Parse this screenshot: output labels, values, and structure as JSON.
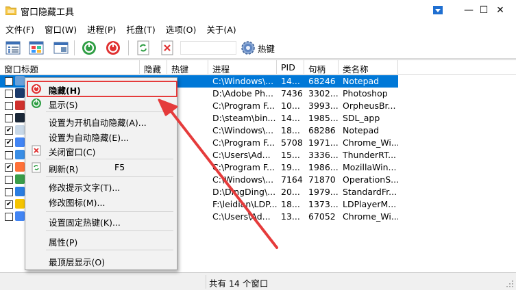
{
  "window": {
    "title": "窗口隐藏工具",
    "controls": {
      "help": "▼",
      "minimize": "—",
      "maximize": "☐",
      "close": "✕"
    }
  },
  "menu": [
    "文件(F)",
    "窗口(W)",
    "进程(P)",
    "托盘(T)",
    "选项(O)",
    "关于(A)"
  ],
  "toolbar": {
    "search_value": "",
    "hotkey_label": "热键",
    "icons": [
      "list-view-icon",
      "grid-view-icon",
      "window-icon",
      "show-icon",
      "hide-icon",
      "refresh-icon",
      "close-window-icon",
      "gear-icon"
    ]
  },
  "table": {
    "columns": [
      "窗口标题",
      "隐藏",
      "热键",
      "进程",
      "PID",
      "句柄",
      "类名称"
    ],
    "rows": [
      {
        "checked": false,
        "title": "",
        "hidden": "",
        "hotkey": "",
        "process": "C:\\Windows\\...",
        "pid": "14...",
        "handle": "68246",
        "class": "Notepad",
        "selected": true
      },
      {
        "checked": false,
        "title": "",
        "hidden": "",
        "hotkey": "",
        "process": "D:\\Adobe Ph...",
        "pid": "7436",
        "handle": "3302...",
        "class": "Photoshop"
      },
      {
        "checked": false,
        "title": "",
        "hidden": "",
        "hotkey": "",
        "process": "C:\\Program F...",
        "pid": "10...",
        "handle": "3993...",
        "class": "OrpheusBr..."
      },
      {
        "checked": false,
        "title": "",
        "hidden": "",
        "hotkey": "",
        "process": "D:\\steam\\bin...",
        "pid": "14...",
        "handle": "1985...",
        "class": "SDL_app"
      },
      {
        "checked": true,
        "title": "",
        "hidden": "",
        "hotkey": "",
        "process": "C:\\Windows\\...",
        "pid": "18...",
        "handle": "68286",
        "class": "Notepad"
      },
      {
        "checked": true,
        "title": "",
        "hidden": "",
        "hotkey": "",
        "process": "C:\\Program F...",
        "pid": "5708",
        "handle": "1971...",
        "class": "Chrome_Wi..."
      },
      {
        "checked": false,
        "title": "",
        "hidden": "",
        "hotkey": "",
        "process": "C:\\Users\\Ad...",
        "pid": "15...",
        "handle": "3336...",
        "class": "ThunderRT..."
      },
      {
        "checked": true,
        "title": "",
        "hidden": "",
        "hotkey": "",
        "process": "C:\\Program F...",
        "pid": "19...",
        "handle": "1986...",
        "class": "MozillaWin..."
      },
      {
        "checked": false,
        "title": "",
        "hidden": "",
        "hotkey": "",
        "process": "C:\\Windows\\...",
        "pid": "7164",
        "handle": "71870",
        "class": "OperationS..."
      },
      {
        "checked": false,
        "title": "",
        "hidden": "",
        "hotkey": "",
        "process": "D:\\DingDing\\...",
        "pid": "20...",
        "handle": "1979...",
        "class": "StandardFr..."
      },
      {
        "checked": true,
        "title": "",
        "hidden": "",
        "hotkey": "",
        "process": "F:\\leidian\\LDP...",
        "pid": "18...",
        "handle": "1373...",
        "class": "LDPlayerM..."
      },
      {
        "checked": false,
        "title": "",
        "hidden": "",
        "hotkey": "",
        "process": "C:\\Users\\Ad...",
        "pid": "13...",
        "handle": "67052",
        "class": "Chrome_Wi..."
      }
    ],
    "row_icon_colors": [
      "#6aa0d8",
      "#1b3a6b",
      "#d0312d",
      "#1b2838",
      "#c8d8e8",
      "#4285f4",
      "#3a8ee6",
      "#ff7139",
      "#3a9d4a",
      "#2a7de1",
      "#f5c400",
      "#4285f4"
    ]
  },
  "context_menu": {
    "items": [
      {
        "label": "隐藏(H)",
        "bold": true,
        "icon": "hide-icon"
      },
      {
        "label": "显示(S)",
        "icon": "show-icon"
      },
      {
        "label": "设置为开机自动隐藏(A)..."
      },
      {
        "label": "设置为自动隐藏(E)..."
      },
      {
        "label": "关闭窗口(C)",
        "icon": "close-window-icon"
      },
      {
        "label": "刷新(R)",
        "shortcut": "F5",
        "icon": "refresh-icon"
      },
      {
        "label": "修改提示文字(T)..."
      },
      {
        "label": "修改图标(M)..."
      },
      {
        "label": "设置固定热键(K)..."
      },
      {
        "label": "属性(P)"
      },
      {
        "label": "最顶层显示(O)"
      }
    ]
  },
  "status": {
    "text": "共有 14 个窗口"
  },
  "colors": {
    "selection": "#0078d7",
    "highlight": "#e53b3b"
  }
}
